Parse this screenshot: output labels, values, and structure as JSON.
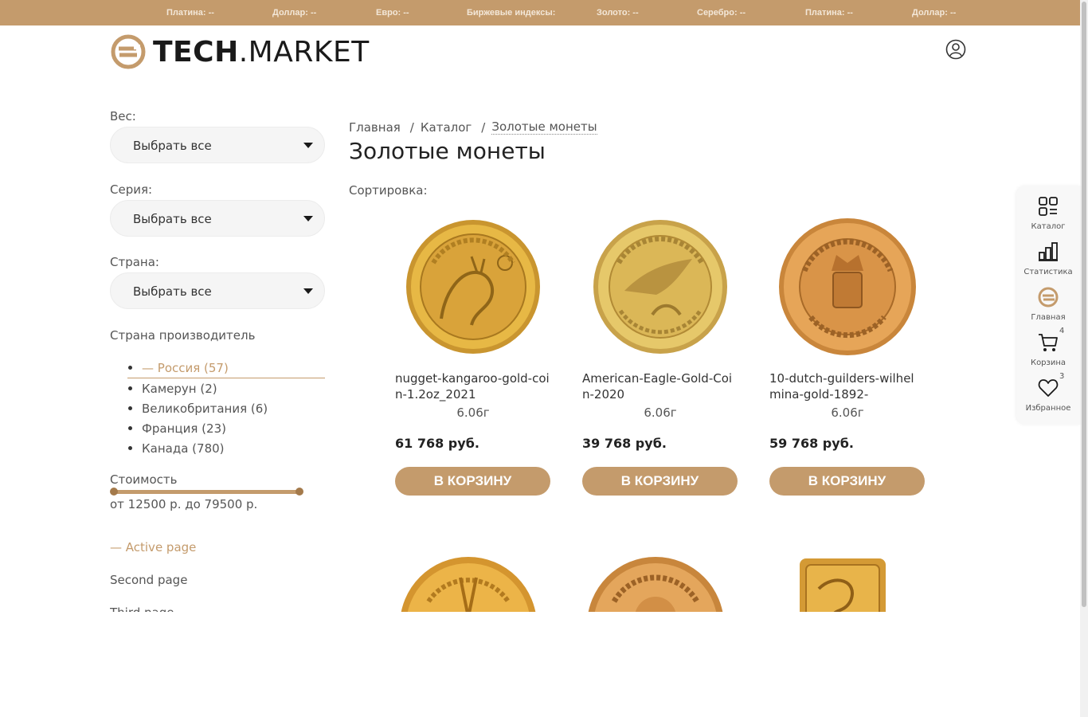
{
  "ticker": [
    "Платина: --",
    "Доллар: --",
    "Евро: --",
    "Биржевые индексы:",
    "Золото: --",
    "Серебро: --",
    "Платина: --",
    "Доллар: --"
  ],
  "header": {
    "brand_bold": "TECH",
    "brand_light": ".MARKET",
    "user_icon": "user-circle-icon"
  },
  "filters": {
    "weight": {
      "label": "Вес:",
      "value": "Выбрать все"
    },
    "series": {
      "label": "Серия:",
      "value": "Выбрать все"
    },
    "country": {
      "label": "Страна:",
      "value": "Выбрать все"
    }
  },
  "producer": {
    "title": "Страна производитель",
    "items": [
      {
        "label": "— Россия (57)",
        "active": true
      },
      {
        "label": "Камерун (2)",
        "active": false
      },
      {
        "label": "Великобритания (6)",
        "active": false
      },
      {
        "label": "Франция (23)",
        "active": false
      },
      {
        "label": "Канада (780)",
        "active": false
      }
    ]
  },
  "price": {
    "title": "Стоимость",
    "range_text": "от 12500 р. до 79500 р.",
    "min": 12500,
    "max": 79500
  },
  "side_nav": [
    "— Active page",
    "Second page",
    "Third page"
  ],
  "breadcrumb": [
    "Главная",
    "Каталог",
    "Золотые монеты"
  ],
  "page_title": "Золотые монеты",
  "sort_label": "Сортировка:",
  "products": [
    {
      "name": "nugget-kangaroo-gold-coin-1.2oz_2021",
      "weight": "6.06г",
      "price": "61 768 руб.",
      "button": "В КОРЗИНУ"
    },
    {
      "name": "American-Eagle-Gold-Coin-2020",
      "weight": "6.06г",
      "price": "39 768 руб.",
      "button": "В КОРЗИНУ"
    },
    {
      "name": "10-dutch-guilders-wilhelmina-gold-1892-",
      "weight": "6.06г",
      "price": "59 768 руб.",
      "button": "В КОРЗИНУ"
    }
  ],
  "float_panel": [
    {
      "label": "Каталог",
      "icon": "catalog-icon"
    },
    {
      "label": "Статистика",
      "icon": "stats-icon"
    },
    {
      "label": "Главная",
      "icon": "home-logo-icon"
    },
    {
      "label": "Корзина",
      "icon": "cart-icon",
      "count": "4"
    },
    {
      "label": "Избранное",
      "icon": "heart-icon",
      "count": "3"
    }
  ],
  "colors": {
    "accent": "#c49b6c",
    "accent_dark": "#a47a4b",
    "gold": "#e2b13c"
  }
}
